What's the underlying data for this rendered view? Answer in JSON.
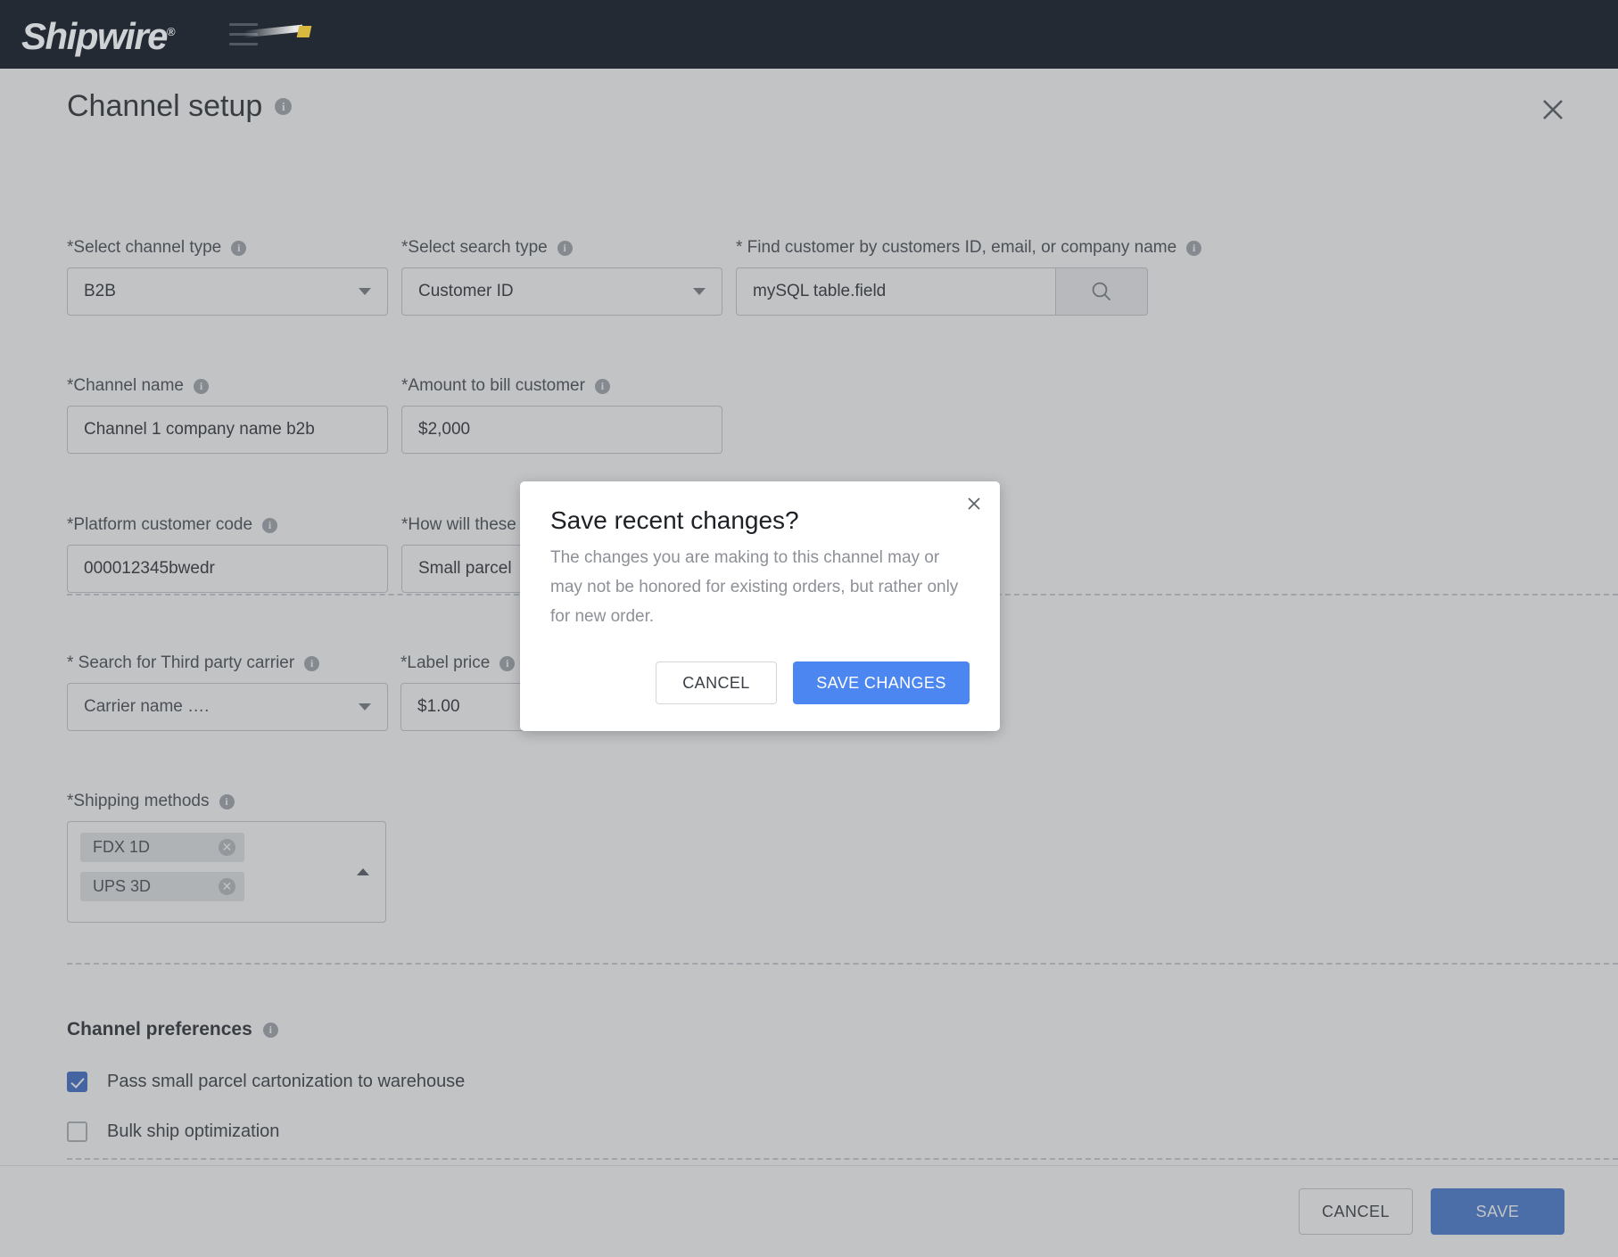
{
  "topbar": {
    "brand": "Shipwire",
    "brand_registered": "®",
    "menu_icon": "hamburger-icon"
  },
  "page": {
    "title": "Channel setup",
    "close_icon": "close-icon",
    "info_icon": "i"
  },
  "fields": {
    "channel_type": {
      "label": "*Select channel type",
      "value": "B2B"
    },
    "search_type": {
      "label": "*Select search type",
      "value": "Customer ID"
    },
    "find_customer": {
      "label": "* Find customer by customers ID, email, or company name",
      "value": "mySQL table.field",
      "search_icon": "search-icon"
    },
    "channel_name": {
      "label": "*Channel name",
      "value": "Channel 1 company name b2b"
    },
    "amount_to_bill": {
      "label": "*Amount to bill customer",
      "value": "$2,000"
    },
    "platform_customer_code": {
      "label": "*Platform customer code",
      "value": "000012345bwedr"
    },
    "shipping_question": {
      "label": "*How will these orders be shipped?",
      "value": "Small parcel"
    },
    "third_party_carrier": {
      "label": "* Search for Third party carrier",
      "value": "Carrier name …."
    },
    "label_price": {
      "label": "*Label price",
      "value": "$1.00"
    },
    "shipping_methods": {
      "label": "*Shipping methods",
      "chips": [
        {
          "label": "FDX 1D",
          "remove_icon": "remove-chip-icon"
        },
        {
          "label": "UPS 3D",
          "remove_icon": "remove-chip-icon"
        }
      ],
      "caret_icon": "chevron-up-icon"
    }
  },
  "preferences": {
    "title": "Channel preferences",
    "items": [
      {
        "label": "Pass small parcel cartonization to warehouse",
        "checked": true
      },
      {
        "label": "Bulk ship optimization",
        "checked": false
      }
    ]
  },
  "footer": {
    "cancel_label": "CANCEL",
    "save_label": "SAVE"
  },
  "modal": {
    "title": "Save recent changes?",
    "body": "The changes you are making to this channel may or may not be honored for existing orders, but rather only for new order.",
    "cancel_label": "CANCEL",
    "save_label": "SAVE CHANGES",
    "close_icon": "close-icon"
  },
  "colors": {
    "topbar_bg": "#242a34",
    "brand_accent": "#d9b93d",
    "primary_blue": "#3b72cf",
    "modal_blue": "#4c86f0",
    "checkbox_blue": "#2f63c4"
  }
}
